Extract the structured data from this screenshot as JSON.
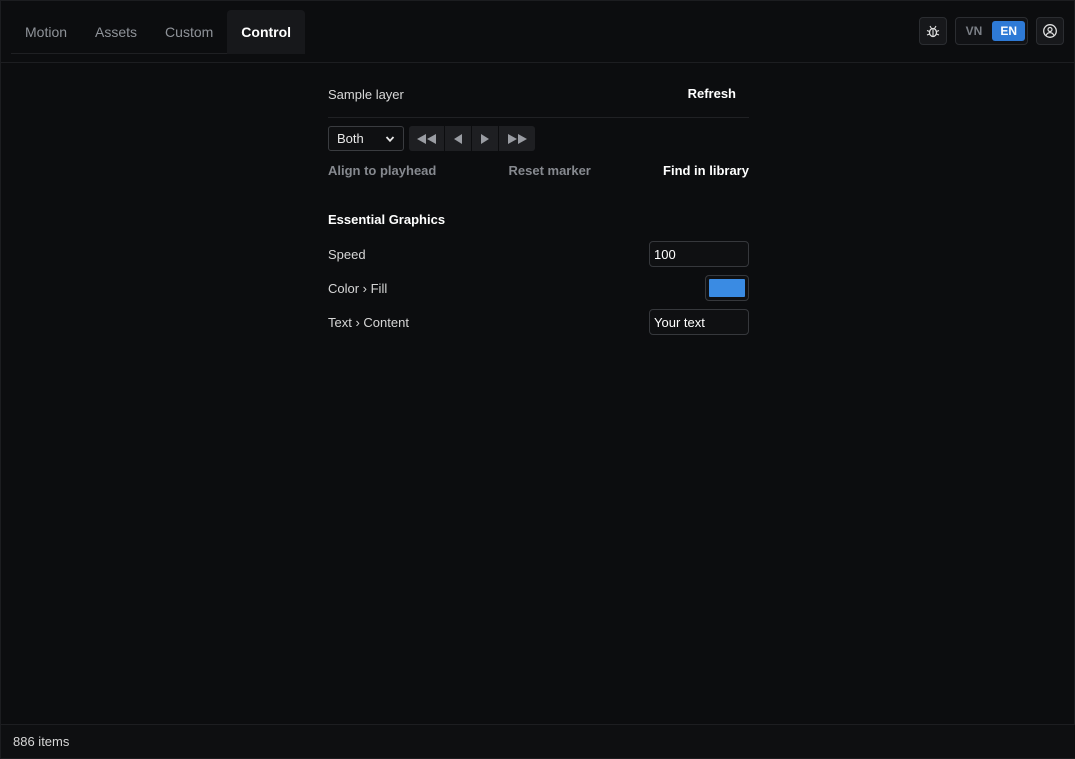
{
  "tabs": [
    {
      "label": "Motion",
      "active": false
    },
    {
      "label": "Assets",
      "active": false
    },
    {
      "label": "Custom",
      "active": false
    },
    {
      "label": "Control",
      "active": true
    }
  ],
  "header": {
    "theme_icon": "bug-icon",
    "languages": [
      {
        "label": "VN",
        "active": false
      },
      {
        "label": "EN",
        "active": true
      }
    ],
    "account_icon": "user-circle-icon"
  },
  "layer": {
    "name": "Sample layer",
    "refresh_label": "Refresh"
  },
  "controls": {
    "mode_selected": "Both",
    "transport_icons": [
      "rewind-icon",
      "step-back-icon",
      "play-icon",
      "fast-forward-icon"
    ]
  },
  "actions": {
    "align": "Align to playhead",
    "reset": "Reset marker",
    "find": "Find in library"
  },
  "essential_graphics": {
    "title": "Essential Graphics",
    "speed_label": "Speed",
    "speed_value": "100",
    "color_label": "Color › Fill",
    "color_value": "#3a8be3",
    "text_label": "Text › Content",
    "text_value": "Your text"
  },
  "status": {
    "items": "886 items"
  },
  "colors": {
    "accent": "#2e7ad6",
    "background": "#0c0d0f"
  }
}
